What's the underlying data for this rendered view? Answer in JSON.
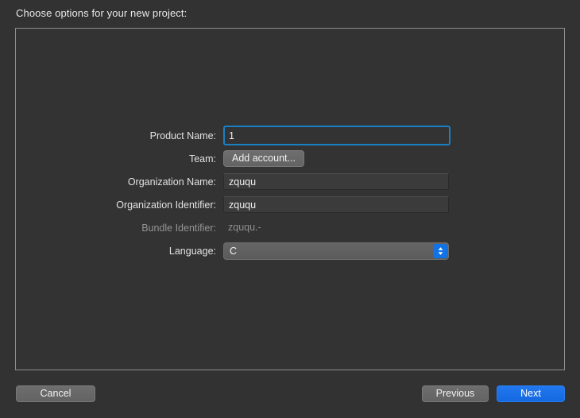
{
  "window": {
    "prompt": "Choose options for your new project:"
  },
  "form": {
    "fields": [
      {
        "label": "Product Name:",
        "type": "textfield",
        "value": "1",
        "placeholder": "",
        "focused": true,
        "disabled": false
      },
      {
        "label": "Team:",
        "type": "button",
        "value": "Add account...",
        "disabled": false
      },
      {
        "label": "Organization Name:",
        "type": "textfield",
        "value": "zququ",
        "placeholder": "",
        "focused": false,
        "disabled": false
      },
      {
        "label": "Organization Identifier:",
        "type": "textfield",
        "value": "zququ",
        "placeholder": "",
        "focused": false,
        "disabled": false
      },
      {
        "label": "Bundle Identifier:",
        "type": "static",
        "value": "zququ.-",
        "disabled": true
      },
      {
        "label": "Language:",
        "type": "popup",
        "value": "C",
        "options": [
          "C"
        ],
        "disabled": false
      }
    ]
  },
  "footer": {
    "cancel_label": "Cancel",
    "previous_label": "Previous",
    "next_label": "Next"
  },
  "icons": {
    "popup_stepper": "chevron-up-down-icon"
  },
  "colors": {
    "window_background": "#323232",
    "panel_background": "#333333",
    "panel_border": "#8e8e8e",
    "focus_ring": "#1a80c4",
    "accent_blue": "#1273e6",
    "default_button_blue": "#1468e0",
    "text_primary": "#e8e8e8",
    "text_disabled": "#8f8f8f"
  }
}
